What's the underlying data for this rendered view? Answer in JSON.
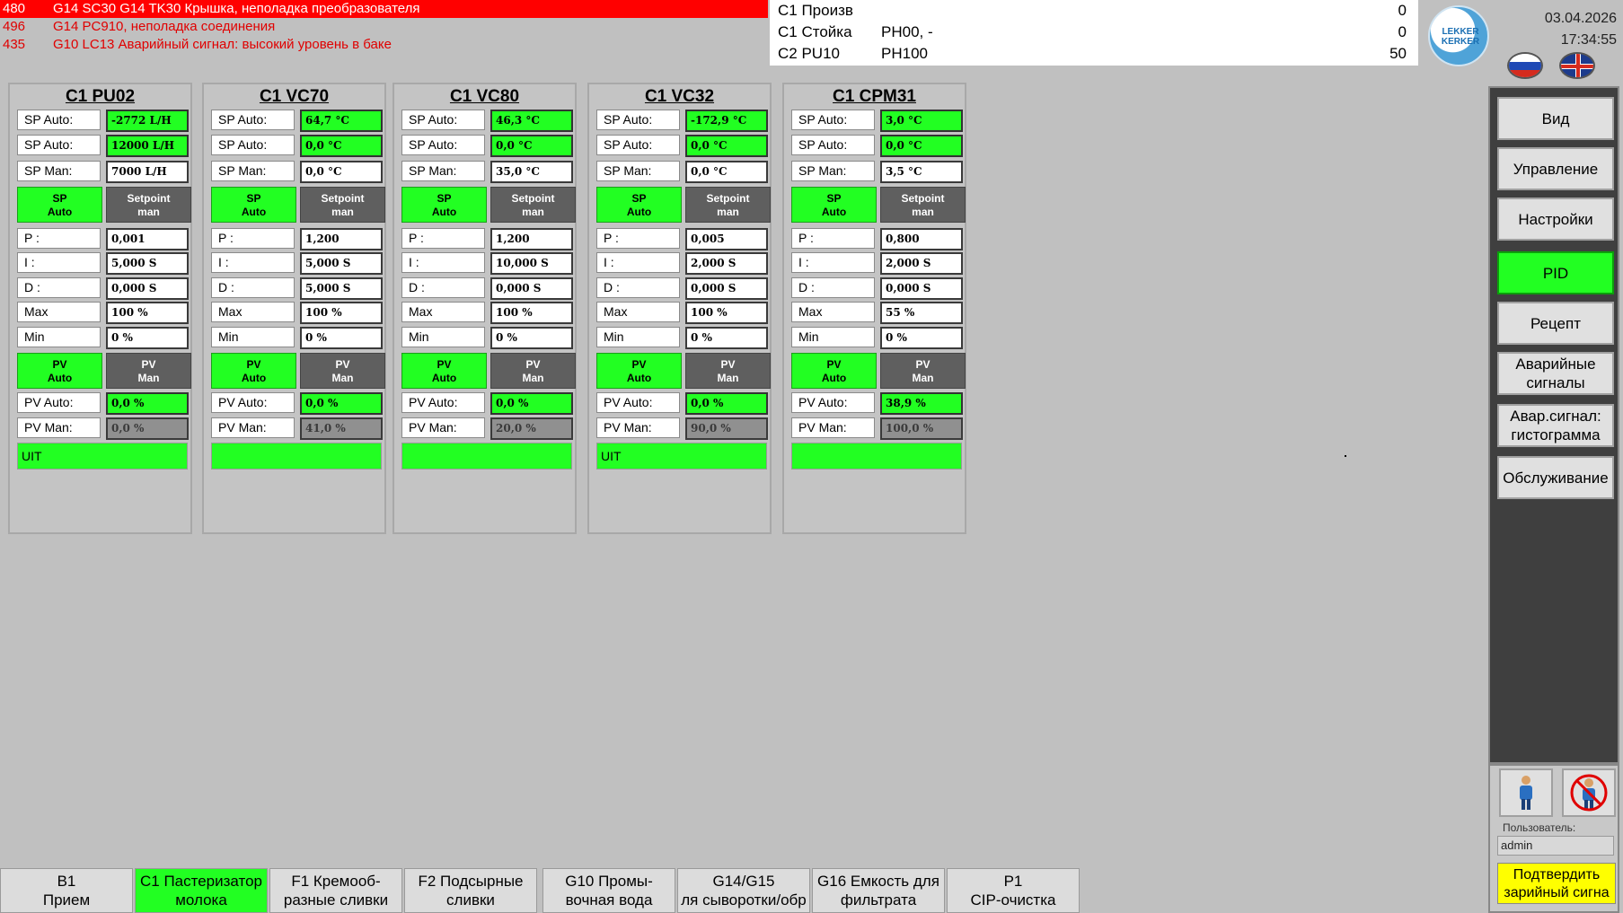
{
  "alarms": [
    {
      "num": "480",
      "text": "G14 SC30 G14 TK30 Крышка, неполадка преобразователя"
    },
    {
      "num": "496",
      "text": "G14 PC910, неполадка соединения"
    },
    {
      "num": "435",
      "text": "G10 LC13 Аварийный сигнал: высокий уровень в баке"
    }
  ],
  "info": [
    {
      "label": "C1  Произв",
      "mid": "",
      "value": "0"
    },
    {
      "label": "C1  Стойка",
      "mid": "PH00, -",
      "value": "0"
    },
    {
      "label": "C2  PU10",
      "mid": "PH100",
      "value": "50"
    }
  ],
  "logo_text": "LEKKER KERKER",
  "date": "03.04.2026",
  "time": "17:34:55",
  "labels": {
    "sp_auto": "SP Auto:",
    "sp_man": "SP Man:",
    "p": "P :",
    "i": "I :",
    "d": "D :",
    "max": "Max",
    "min": "Min",
    "pv_auto": "PV Auto:",
    "pv_man": "PV Man:",
    "sp_auto_btn_1": "SP",
    "sp_auto_btn_2": "Auto",
    "setpoint_btn_1": "Setpoint",
    "setpoint_btn_2": "man",
    "pv_auto_btn_1": "PV",
    "pv_auto_btn_2": "Auto",
    "pv_man_btn_1": "PV",
    "pv_man_btn_2": "Man"
  },
  "panels": [
    {
      "title": "C1 PU02",
      "sp_auto1": "-2772 L/H",
      "sp_auto2": "12000 L/H",
      "sp_man": "7000 L/H",
      "p": "0,001",
      "i": "5,000 S",
      "d": "0,000 S",
      "max": "100 %",
      "min": "0 %",
      "pv_auto": "0,0 %",
      "pv_man": "0,0 %",
      "status": "UIT"
    },
    {
      "title": "C1 VC70",
      "sp_auto1": "64,7 °C",
      "sp_auto2": "0,0 °C",
      "sp_man": "0,0 °C",
      "p": "1,200",
      "i": "5,000 S",
      "d": "5,000 S",
      "max": "100 %",
      "min": "0 %",
      "pv_auto": "0,0 %",
      "pv_man": "41,0 %",
      "status": ""
    },
    {
      "title": "C1 VC80",
      "sp_auto1": "46,3 °C",
      "sp_auto2": "0,0 °C",
      "sp_man": "35,0 °C",
      "p": "1,200",
      "i": "10,000 S",
      "d": "0,000 S",
      "max": "100 %",
      "min": "0 %",
      "pv_auto": "0,0 %",
      "pv_man": "20,0 %",
      "status": ""
    },
    {
      "title": "C1 VC32",
      "sp_auto1": "-172,9 °C",
      "sp_auto2": "0,0 °C",
      "sp_man": "0,0 °C",
      "p": "0,005",
      "i": "2,000 S",
      "d": "0,000 S",
      "max": "100 %",
      "min": "0 %",
      "pv_auto": "0,0 %",
      "pv_man": "90,0 %",
      "status": "UIT"
    },
    {
      "title": "C1 CPM31",
      "sp_auto1": "3,0 °C",
      "sp_auto2": "0,0 °C",
      "sp_man": "3,5 °C",
      "p": "0,800",
      "i": "2,000 S",
      "d": "0,000 S",
      "max": "55 %",
      "min": "0 %",
      "pv_auto": "38,9 %",
      "pv_man": "100,0 %",
      "status": ""
    }
  ],
  "nav": [
    {
      "label": "Вид",
      "active": false
    },
    {
      "label": "Управление",
      "active": false
    },
    {
      "label": "Настройки",
      "active": false
    },
    {
      "label": "PID",
      "active": true
    },
    {
      "label": "Рецепт",
      "active": false
    },
    {
      "label": "Аварийные\nсигналы",
      "active": false
    },
    {
      "label": "Авар.сигнал:\nгистограмма",
      "active": false
    },
    {
      "label": "Обслуживание",
      "active": false
    }
  ],
  "user": {
    "label": "Пользователь:",
    "name": "admin",
    "ack_label": "Подтвердить\nзарийный сигна"
  },
  "tabs": [
    {
      "label": "B1\nПрием",
      "active": false
    },
    {
      "label": "C1 Пастеризатор\nмолока",
      "active": true
    },
    {
      "label": "F1 Кремооб-\nразные сливки",
      "active": false
    },
    {
      "label": "F2 Подсырные\nсливки",
      "active": false
    },
    {
      "label": "G10 Промы-\nвочная вода",
      "active": false
    },
    {
      "label": "G14/G15\nля сыворотки/обр",
      "active": false
    },
    {
      "label": "G16 Емкость для\nфильтрата",
      "active": false
    },
    {
      "label": "P1\nCIP-очистка",
      "active": false
    }
  ],
  "colors": {
    "accent_green": "#22ff22",
    "alarm_red": "#ff0000",
    "ack_yellow": "#ffff00"
  },
  "icons": [
    "user-login-icon",
    "user-logout-icon",
    "flag-ru-icon",
    "flag-en-icon"
  ]
}
